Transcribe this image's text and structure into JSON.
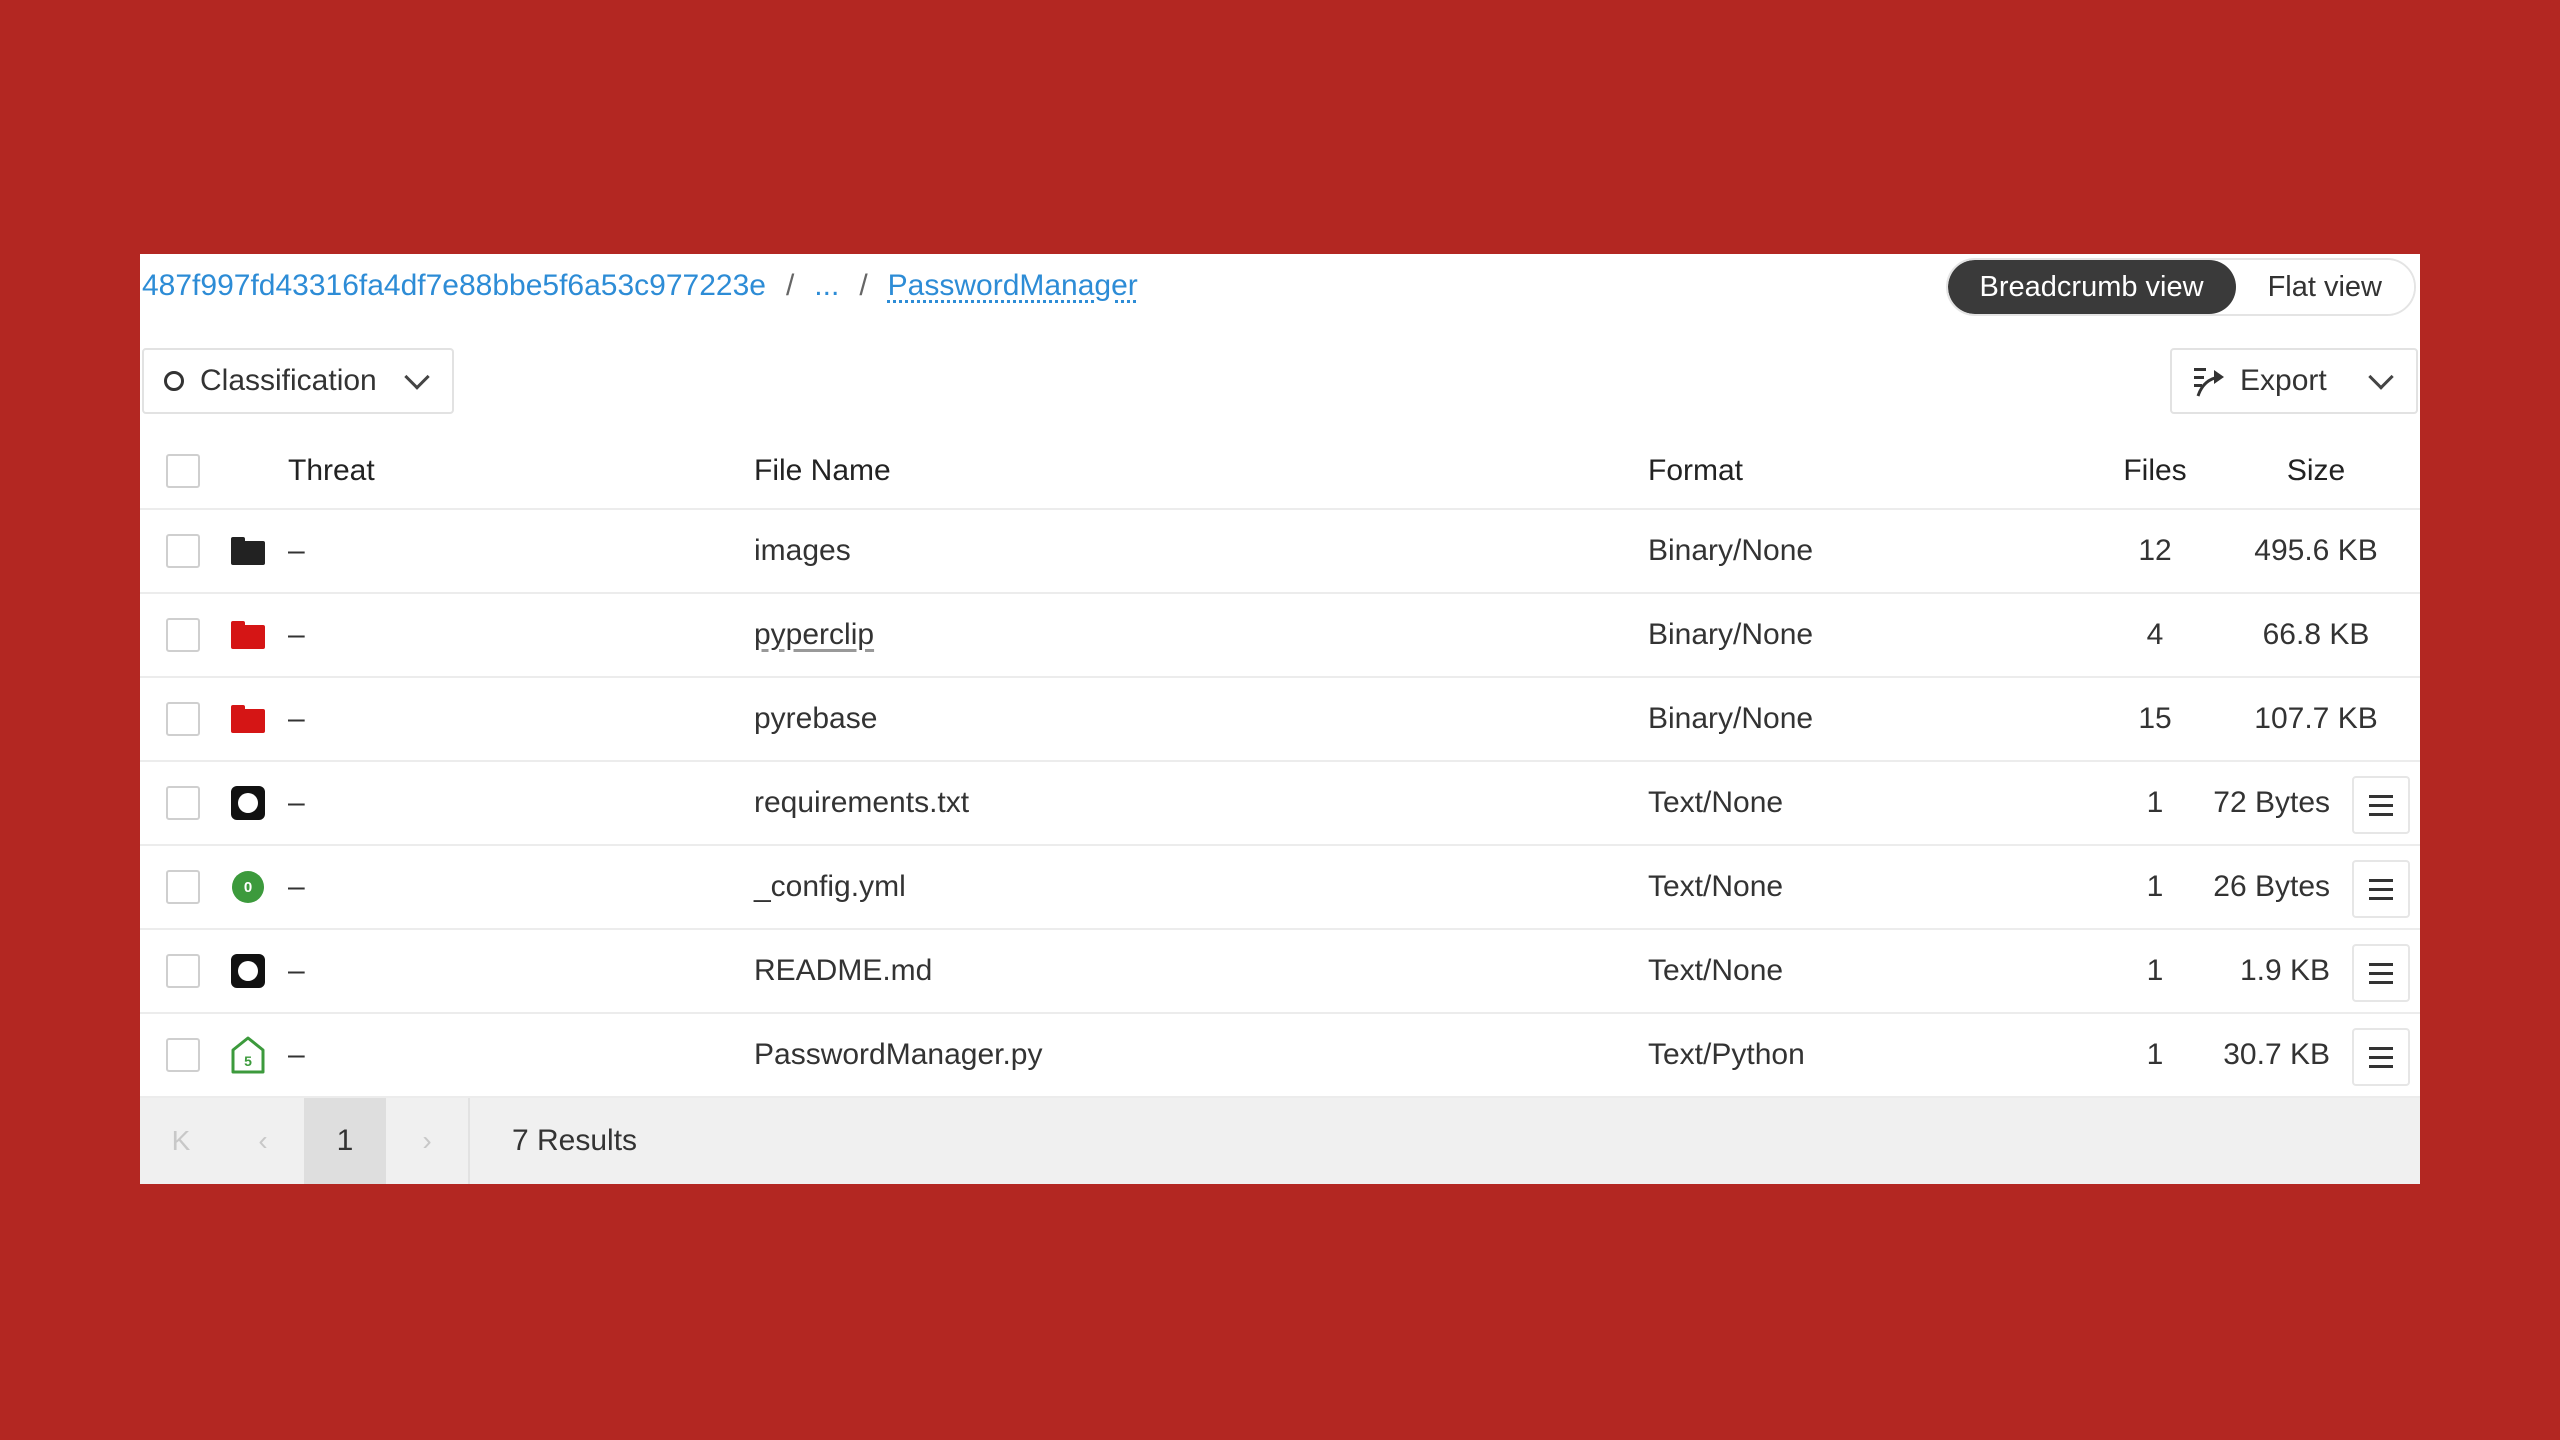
{
  "breadcrumb": {
    "root": "487f997fd43316fa4df7e88bbe5f6a53c977223e",
    "sep1": "/",
    "ellipsis": "...",
    "sep2": "/",
    "current": "PasswordManager"
  },
  "view_toggle": {
    "breadcrumb_label": "Breadcrumb view",
    "flat_label": "Flat view",
    "active": "breadcrumb"
  },
  "toolbar": {
    "classification_label": "Classification",
    "export_label": "Export"
  },
  "table": {
    "headers": {
      "threat": "Threat",
      "file_name": "File Name",
      "format": "Format",
      "files": "Files",
      "size": "Size"
    },
    "rows": [
      {
        "icon": "folder-dark-icon",
        "threat": "–",
        "name": "images",
        "format": "Binary/None",
        "files": "12",
        "size": "495.6 KB",
        "menu": false
      },
      {
        "icon": "folder-red-icon",
        "threat": "–",
        "name": "pyperclip",
        "format": "Binary/None",
        "files": "4",
        "size": "66.8 KB",
        "menu": false
      },
      {
        "icon": "folder-red-icon",
        "threat": "–",
        "name": "pyrebase",
        "format": "Binary/None",
        "files": "15",
        "size": "107.7 KB",
        "menu": false
      },
      {
        "icon": "square-ring-icon",
        "threat": "–",
        "name": "requirements.txt",
        "format": "Text/None",
        "files": "1",
        "size": "72 Bytes",
        "menu": true
      },
      {
        "icon": "green-badge-icon",
        "badge": "0",
        "threat": "–",
        "name": "_config.yml",
        "format": "Text/None",
        "files": "1",
        "size": "26 Bytes",
        "menu": true
      },
      {
        "icon": "square-ring-icon",
        "threat": "–",
        "name": "README.md",
        "format": "Text/None",
        "files": "1",
        "size": "1.9 KB",
        "menu": true
      },
      {
        "icon": "house-badge-icon",
        "badge": "5",
        "threat": "–",
        "name": "PasswordManager.py",
        "format": "Text/Python",
        "files": "1",
        "size": "30.7 KB",
        "menu": true
      }
    ]
  },
  "pager": {
    "first": "K",
    "prev": "‹",
    "current_page": "1",
    "next": "›",
    "results": "7 Results"
  },
  "colors": {
    "background": "#b32722",
    "link": "#2d8cd6",
    "folder_red": "#d51515",
    "badge_green": "#3c9a3c"
  }
}
